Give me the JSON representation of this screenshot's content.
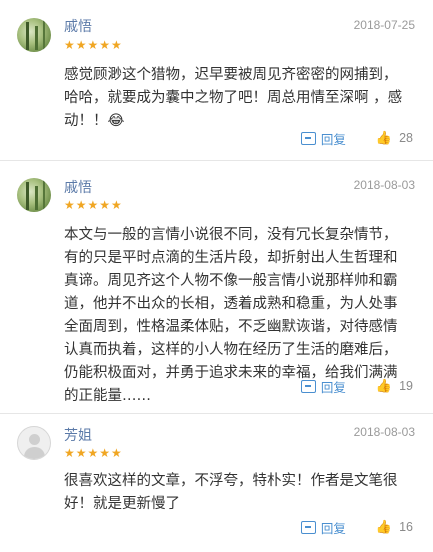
{
  "comments": [
    {
      "username": "戚悟",
      "date": "2018-07-25",
      "stars": "★★★★★",
      "lines": [
        "感觉顾渺这个猎物，迟早要被周见齐密密的网捕到，",
        "哈哈，就要成为囊中之物了吧！周总用情至深啊 ，感",
        "动！！😂"
      ],
      "reply_label": "回复",
      "likes": "28",
      "avatar": "photo"
    },
    {
      "username": "戚悟",
      "date": "2018-08-03",
      "stars": "★★★★★",
      "lines": [
        "本文与一般的言情小说很不同，没有冗长复杂情节，",
        "有的只是平时点滴的生活片段，却折射出人生哲理和",
        "真谛。周见齐这个人物不像一般言情小说那样帅和霸",
        "道，他并不出众的长相，透着成熟和稳重，为人处事",
        "全面周到，性格温柔体贴，不乏幽默诙谐，对待感情",
        "认真而执着，这样的小人物在经历了生活的磨难后，",
        "仍能积极面对，并勇于追求未来的幸福，给我们满满",
        "的正能量……"
      ],
      "reply_label": "回复",
      "likes": "19",
      "avatar": "photo"
    },
    {
      "username": "芳姐",
      "date": "2018-08-03",
      "stars": "★★★★★",
      "lines": [
        "很喜欢这样的文章，不浮夸，特朴实！作者是文笔很",
        "好！就是更新慢了"
      ],
      "reply_label": "回复",
      "likes": "16",
      "avatar": "default"
    }
  ],
  "icons": {
    "reply": "reply-icon",
    "like": "thumbs-up-icon"
  },
  "colors": {
    "username": "#5b7aa8",
    "star": "#f0a623",
    "reply": "#4a8fd0"
  }
}
